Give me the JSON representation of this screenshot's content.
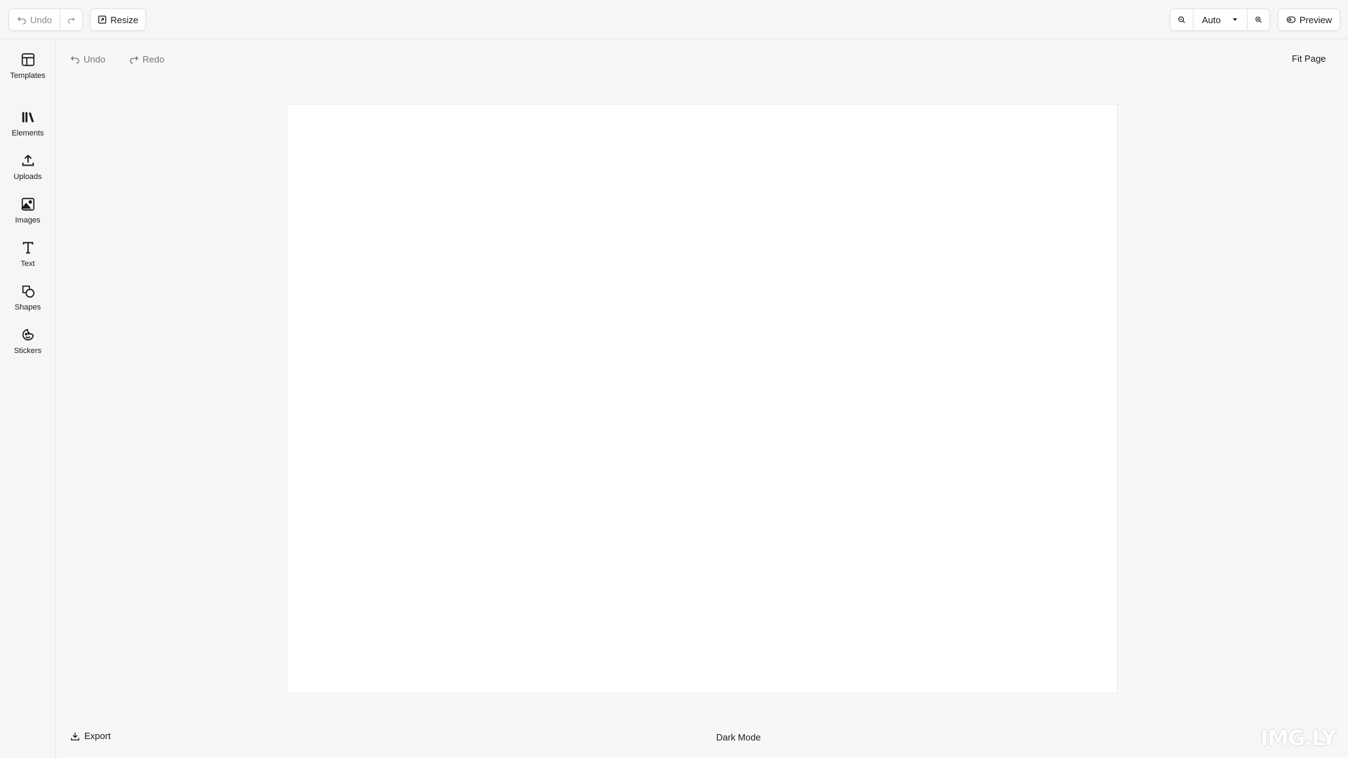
{
  "toolbar": {
    "undo_label": "Undo",
    "resize_label": "Resize",
    "zoom_level": "Auto",
    "preview_label": "Preview"
  },
  "sidebar": {
    "items": [
      {
        "label": "Templates",
        "icon": "layout-icon"
      },
      {
        "label": "Elements",
        "icon": "library-icon"
      },
      {
        "label": "Uploads",
        "icon": "upload-icon"
      },
      {
        "label": "Images",
        "icon": "image-icon"
      },
      {
        "label": "Text",
        "icon": "text-icon"
      },
      {
        "label": "Shapes",
        "icon": "shapes-icon"
      },
      {
        "label": "Stickers",
        "icon": "sticker-icon"
      }
    ]
  },
  "canvas": {
    "undo_label": "Undo",
    "redo_label": "Redo",
    "fit_page_label": "Fit Page",
    "export_label": "Export",
    "dark_mode_label": "Dark Mode"
  },
  "brand": {
    "logo_text": "IMG.LY"
  }
}
